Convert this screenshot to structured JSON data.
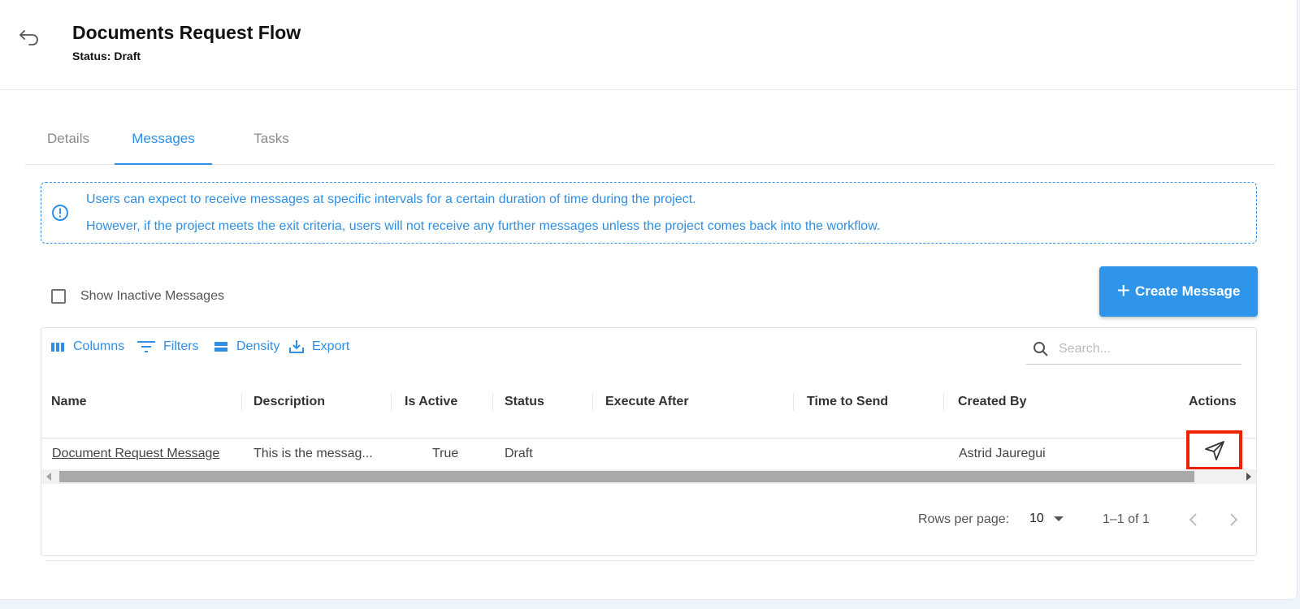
{
  "header": {
    "title": "Documents Request Flow",
    "status_label": "Status:",
    "status_value": "Draft"
  },
  "tabs": [
    {
      "label": "Details",
      "active": false
    },
    {
      "label": "Messages",
      "active": true
    },
    {
      "label": "Tasks",
      "active": false
    }
  ],
  "info": {
    "line1": "Users can expect to receive messages at specific intervals for a certain duration of time during the project.",
    "line2": "However, if the project meets the exit criteria, users will not receive any further messages unless the project comes back into the workflow."
  },
  "controls": {
    "show_inactive_label": "Show Inactive Messages",
    "create_label": "Create Message"
  },
  "toolbar": {
    "columns": "Columns",
    "filters": "Filters",
    "density": "Density",
    "export": "Export",
    "search_placeholder": "Search..."
  },
  "table": {
    "columns": [
      "Name",
      "Description",
      "Is Active",
      "Status",
      "Execute After",
      "Time to Send",
      "Created By",
      "Actions"
    ],
    "rows": [
      {
        "name": "Document Request Message",
        "description": "This is the messag...",
        "is_active": "True",
        "status": "Draft",
        "execute_after": "",
        "time_to_send": "",
        "created_by": "Astrid Jauregui",
        "action_icon": "send-icon"
      }
    ]
  },
  "pagination": {
    "rows_per_page_label": "Rows per page:",
    "rows_per_page_value": "10",
    "range": "1–1 of 1"
  },
  "colors": {
    "accent": "#2f8fe6",
    "highlight": "#ee2200"
  }
}
